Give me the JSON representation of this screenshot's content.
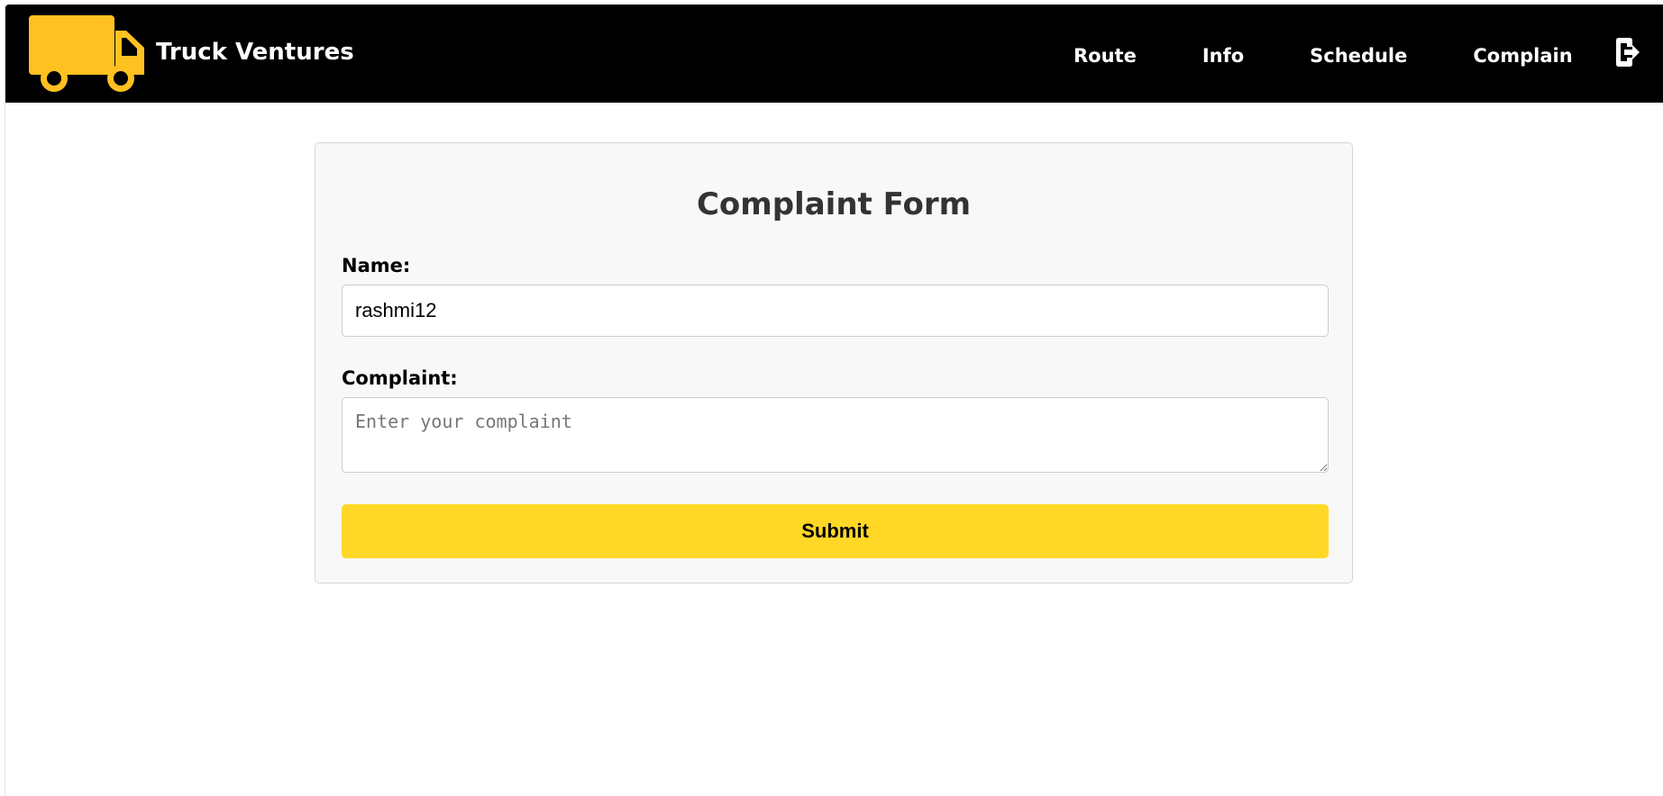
{
  "header": {
    "brand_name": "Truck Ventures",
    "logo_icon": "truck-icon",
    "nav_items": [
      {
        "label": "Route"
      },
      {
        "label": "Info"
      },
      {
        "label": "Schedule"
      },
      {
        "label": "Complain"
      }
    ],
    "logout_icon": "logout-icon"
  },
  "form": {
    "title": "Complaint Form",
    "name_label": "Name:",
    "name_value": "rashmi12",
    "complaint_label": "Complaint:",
    "complaint_placeholder": "Enter your complaint",
    "submit_label": "Submit"
  },
  "colors": {
    "header_bg": "#000000",
    "brand_accent": "#ffc121",
    "button_bg": "#ffd726",
    "card_bg": "#f8f8f8"
  }
}
